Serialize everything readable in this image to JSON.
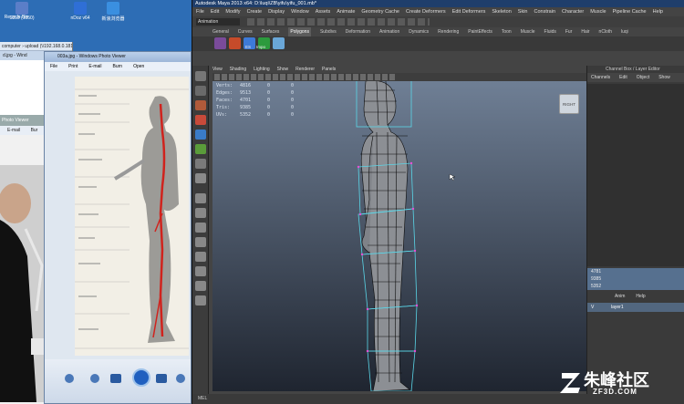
{
  "desktop": {
    "icons": [
      {
        "label": "1050 (1050)",
        "color": "#5b7ec8"
      },
      {
        "label": "Recycle Bin",
        "color": "#7aa0d0"
      },
      {
        "label": "nDoz v64",
        "color": "#2f6fd6"
      },
      {
        "label": "新浪浏览器",
        "color": "#3a8fe0"
      }
    ]
  },
  "explorer": {
    "path": "computer › upload (\\\\192.168.0.181\\Y:\\) › Class3 › 教学 · 影资料 › mo › 0901 ›",
    "tab": "d.jpg - Wind",
    "viewer_title": "Photo Viewer",
    "menu": [
      "E-mail",
      "Bur"
    ]
  },
  "photo_viewer": {
    "title": "003a.jpg - Windows Photo Viewer",
    "menu": [
      "File",
      "Print",
      "E-mail",
      "Burn",
      "Open"
    ]
  },
  "maya": {
    "title": "Autodesk Maya 2013 x64: D:\\luqi\\ZB\\yifu\\yifu_001.mb*",
    "menu": [
      "File",
      "Edit",
      "Modify",
      "Create",
      "Display",
      "Window",
      "Assets",
      "Animate",
      "Geometry Cache",
      "Create Deformers",
      "Edit Deformers",
      "Skeleton",
      "Skin",
      "Constrain",
      "Character",
      "Muscle",
      "Pipeline Cache",
      "Help"
    ],
    "mode": "Animation",
    "shelf_tabs": [
      "General",
      "Curves",
      "Surfaces",
      "Polygons",
      "Subdivs",
      "Deformation",
      "Animation",
      "Dynamics",
      "Rendering",
      "PaintEffects",
      "Toon",
      "Muscle",
      "Fluids",
      "Fur",
      "Hair",
      "nCloth",
      "luqi"
    ],
    "shelf_selected": "Polygons",
    "shelf_labels": [
      "ES",
      "Impo"
    ],
    "viewport_menu": [
      "View",
      "Shading",
      "Lighting",
      "Show",
      "Renderer",
      "Panels"
    ],
    "hud": [
      {
        "k": "Verts:",
        "v": "4816",
        "z": "0",
        "z2": "0"
      },
      {
        "k": "Edges:",
        "v": "9513",
        "z": "0",
        "z2": "0"
      },
      {
        "k": "Faces:",
        "v": "4701",
        "z": "0",
        "z2": "0"
      },
      {
        "k": "Tris:",
        "v": "9385",
        "z": "0",
        "z2": "0"
      },
      {
        "k": "UVs:",
        "v": "5352",
        "z": "0",
        "z2": "0"
      }
    ],
    "camera_label": "RIGHT",
    "help_line": "MEL",
    "channel_box_title": "Channel Box / Layer Editor",
    "channel_menu": [
      "Channels",
      "Edit",
      "Object",
      "Show"
    ],
    "channel_values": [
      "4781",
      "9385",
      "5352"
    ],
    "layer_tabs": [
      "Anim",
      "Help"
    ],
    "layer_name": "layer1",
    "layer_flag": "V"
  },
  "watermark": {
    "text": "朱峰社区",
    "url": "ZF3D.COM"
  }
}
